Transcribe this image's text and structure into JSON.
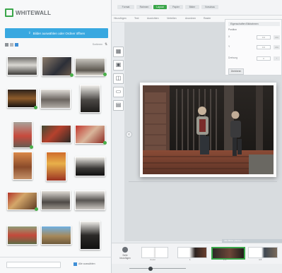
{
  "app": {
    "logo_text": "WHITEWALL"
  },
  "left_panel": {
    "upload_label": "Bilder auswählen oder Ordner öffnen",
    "sort_label": "Sortieren"
  },
  "tabs": [
    "Format",
    "Rahmen",
    "Layout",
    "Papier",
    "Bilder",
    "Vorschau"
  ],
  "active_tab_index": 2,
  "tools": [
    "Hinzufügen",
    "Text",
    "Ausrichten",
    "Verteilen",
    "Anordnen",
    "Raster"
  ],
  "properties": {
    "header": "Eigenschaften Bildrahmen",
    "subheader": "Position",
    "rows": [
      {
        "label": "X",
        "value": "0.0",
        "unit": "cm"
      },
      {
        "label": "Y",
        "value": "0.0",
        "unit": "cm"
      },
      {
        "label": "Drehung",
        "value": "0",
        "unit": "°"
      }
    ],
    "button": "Zentrieren"
  },
  "status_bar_text": "Alle Bilder platziert",
  "filmstrip": {
    "add_label": "Seite hinzufügen",
    "labels": [
      "Cover",
      "1",
      "2-3",
      "4-5"
    ]
  },
  "footer": {
    "checkbox_label": "Alle auswählen"
  },
  "colors": {
    "accent": "#3aa64a",
    "upload": "#39a8e0"
  }
}
